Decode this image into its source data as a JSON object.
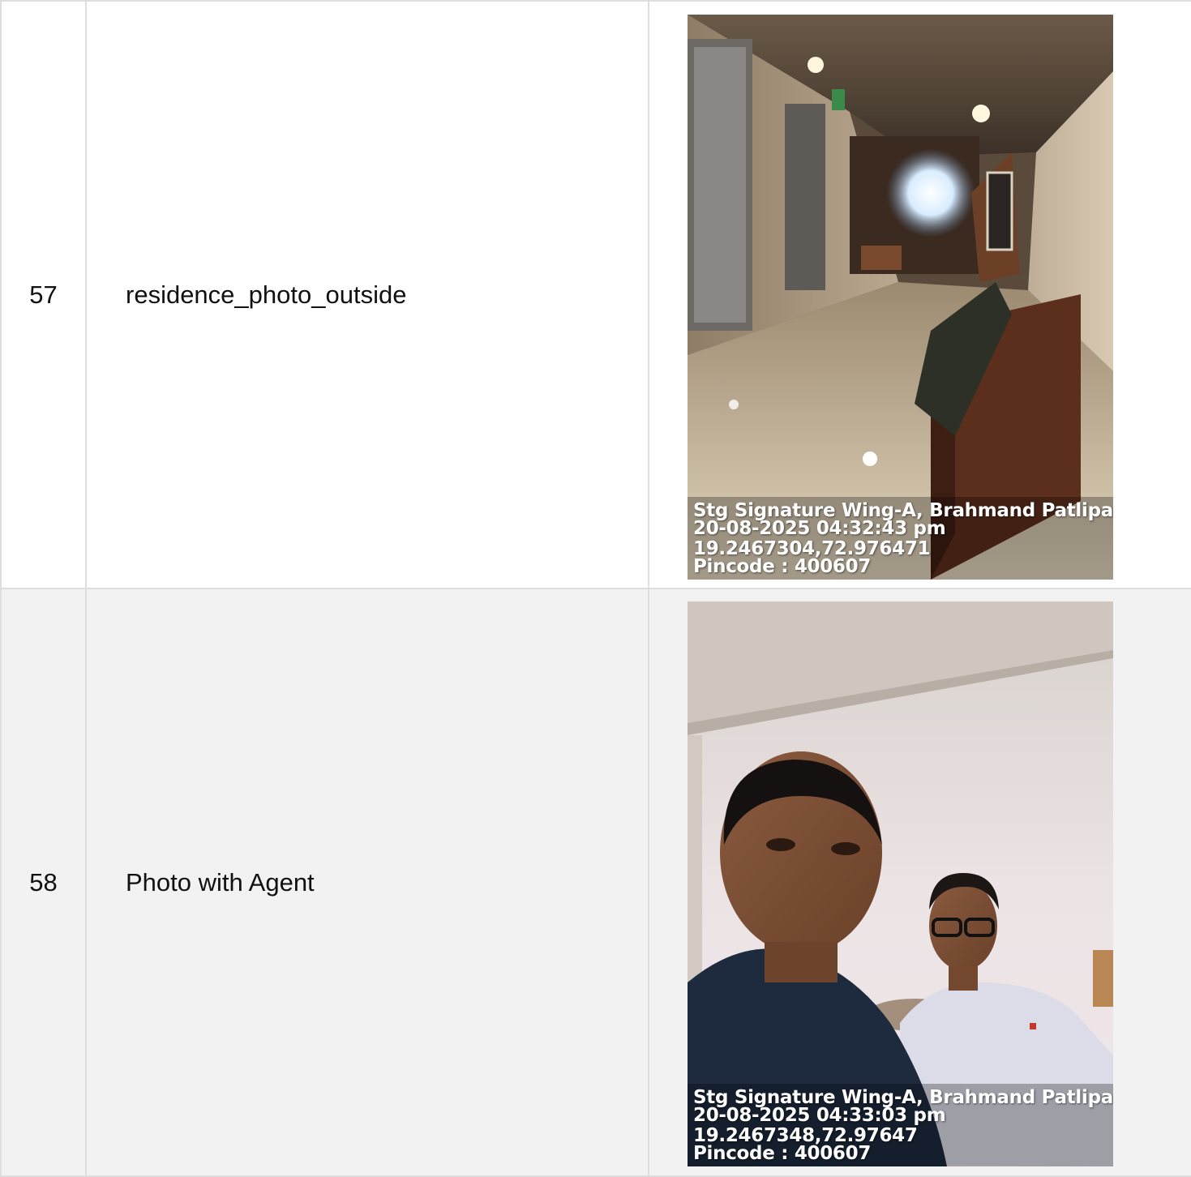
{
  "rows": [
    {
      "number": "57",
      "label": "residence_photo_outside",
      "photo": {
        "subject": "lift-lobby-corridor",
        "stamp": {
          "address": "Stg Signature Wing-A, Brahmand Patlipada L",
          "datetime": "20-08-2025 04:32:43 pm",
          "coords": "19.2467304,72.976471",
          "pincode": "Pincode : 400607"
        }
      }
    },
    {
      "number": "58",
      "label": "Photo with Agent",
      "photo": {
        "subject": "selfie-two-men",
        "stamp": {
          "address": "Stg Signature Wing-A, Brahmand Patlipada L",
          "datetime": "20-08-2025 04:33:03 pm",
          "coords": "19.2467348,72.97647",
          "pincode": "Pincode : 400607"
        }
      }
    }
  ],
  "colors": {
    "border": "#dedede",
    "row_alt": "#f2f2f2",
    "text": "#111111"
  }
}
